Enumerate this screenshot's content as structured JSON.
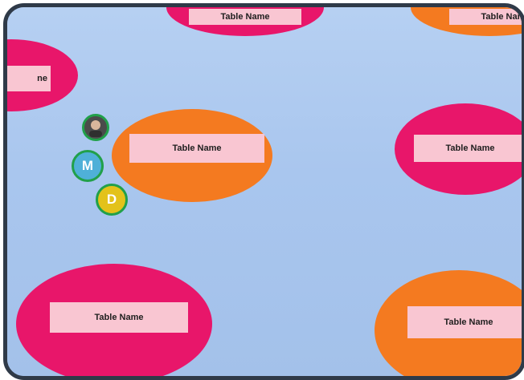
{
  "tables": [
    {
      "id": "t1",
      "label": "Table Name",
      "color": "#e8166a"
    },
    {
      "id": "t2",
      "label": "Table Name",
      "color": "#f47a20"
    },
    {
      "id": "t3",
      "label": "ne",
      "color": "#e8166a"
    },
    {
      "id": "t4",
      "label": "Table Name",
      "color": "#f47a20"
    },
    {
      "id": "t5",
      "label": "Table Name",
      "color": "#e8166a"
    },
    {
      "id": "t6",
      "label": "Table Name",
      "color": "#e8166a"
    },
    {
      "id": "t7",
      "label": "Table Name",
      "color": "#f47a20"
    }
  ],
  "avatars": [
    {
      "letter": "",
      "kind": "photo"
    },
    {
      "letter": "M",
      "color": "#4fb0d8"
    },
    {
      "letter": "D",
      "color": "#e3c21a"
    }
  ]
}
